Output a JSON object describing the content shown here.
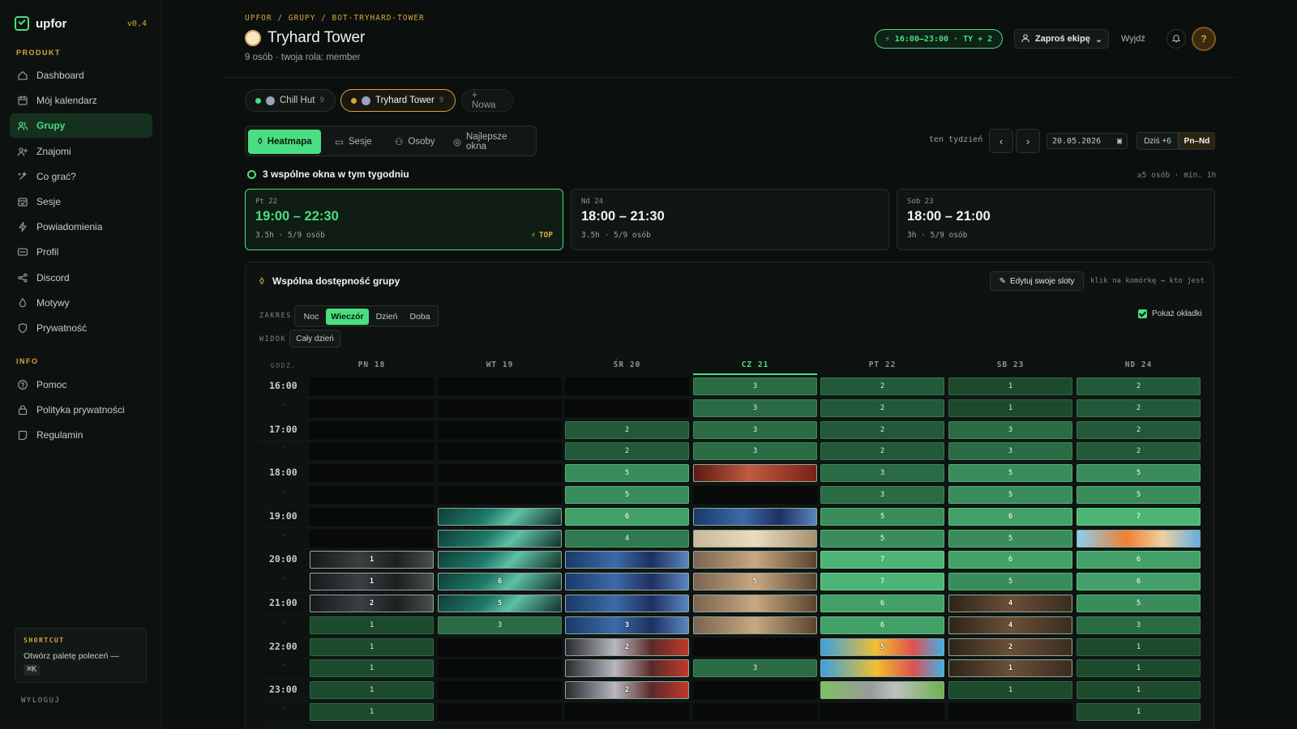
{
  "app": {
    "name": "upfor",
    "version": "v0.4"
  },
  "sidebar": {
    "section_product": "PRODUKT",
    "section_info": "INFO",
    "items": [
      {
        "label": "Dashboard",
        "icon": "home-icon"
      },
      {
        "label": "Mój kalendarz",
        "icon": "calendar-icon"
      },
      {
        "label": "Grupy",
        "icon": "users-icon",
        "active": true
      },
      {
        "label": "Znajomi",
        "icon": "user-plus-icon"
      },
      {
        "label": "Co grać?",
        "icon": "sparkles-icon"
      },
      {
        "label": "Sesje",
        "icon": "calendar-check-icon"
      },
      {
        "label": "Powiadomienia",
        "icon": "bolt-icon"
      },
      {
        "label": "Profil",
        "icon": "id-card-icon"
      },
      {
        "label": "Discord",
        "icon": "share-icon"
      },
      {
        "label": "Motywy",
        "icon": "drop-icon"
      },
      {
        "label": "Prywatność",
        "icon": "shield-icon"
      }
    ],
    "info_items": [
      {
        "label": "Pomoc",
        "icon": "help-circle-icon"
      },
      {
        "label": "Polityka prywatności",
        "icon": "lock-icon"
      },
      {
        "label": "Regulamin",
        "icon": "document-icon"
      }
    ],
    "shortcut_title": "SHORTCUT",
    "shortcut_text": "Otwórz paletę poleceń —",
    "shortcut_key": "⌘K",
    "logout": "WYLOGUJ"
  },
  "header": {
    "breadcrumb": "UPFOR / GRUPY / BOT-TRYHARD-TOWER",
    "title": "Tryhard Tower",
    "subtitle": "9 osób · twoja rola: member",
    "time_pill": "16:00–23:00 · TY + 2",
    "invite": "Zaproś ekipę",
    "logout": "Wyjdź"
  },
  "group_tabs": [
    {
      "name": "Chill Hut",
      "count": "9",
      "dot": "#4ade80"
    },
    {
      "name": "Tryhard Tower",
      "count": "9",
      "dot": "#d9a441",
      "active": true
    },
    {
      "name": "+ Nowa"
    }
  ],
  "view_tabs": [
    "Heatmapa",
    "Sesje",
    "Osoby",
    "Najlepsze okna"
  ],
  "week_nav": {
    "label": "ten tydzień",
    "date": "20.05.2026",
    "today": "Dziś +6",
    "range": "Pn–Nd"
  },
  "common_windows": {
    "title": "3 wspólne okna w tym tygodniu",
    "meta": "≥5 osób · min. 1h",
    "cards": [
      {
        "day": "Pt 22",
        "time": "19:00 – 22:30",
        "sub": "3.5h · 5/9 osób",
        "badge": "TOP"
      },
      {
        "day": "Nd 24",
        "time": "18:00 – 21:30",
        "sub": "3.5h · 5/9 osób"
      },
      {
        "day": "Sob 23",
        "time": "18:00 – 21:00",
        "sub": "3h · 5/9 osób"
      }
    ]
  },
  "panel": {
    "title": "Wspólna dostępność grupy",
    "edit": "Edytuj swoje sloty",
    "hint": "klik na komórkę → kto jest",
    "range_label": "ZAKRES",
    "range": [
      "Noc",
      "Wieczór",
      "Dzień",
      "Doba"
    ],
    "view_label": "WIDOK",
    "view": "Cały dzień",
    "covers": "Pokaż okładki",
    "godz": "GODZ.",
    "days": [
      "PN 18",
      "WT 19",
      "ŚR 20",
      "CZ 21",
      "PT 22",
      "SB 23",
      "ND 24"
    ],
    "hours": [
      "16:00",
      "17:00",
      "18:00",
      "19:00",
      "20:00",
      "21:00",
      "22:00",
      "23:00"
    ],
    "grid": [
      [
        "",
        "",
        "",
        "3",
        "2",
        "1",
        "2"
      ],
      [
        "",
        "",
        "",
        "3",
        "2",
        "1",
        "2"
      ],
      [
        "",
        "",
        "2",
        "3",
        "2",
        "3",
        "2"
      ],
      [
        "",
        "",
        "2",
        "3",
        "2",
        "3",
        "2"
      ],
      [
        "",
        "",
        "5",
        "",
        "3",
        "5",
        "5"
      ],
      [
        "",
        "",
        "5",
        "",
        "3",
        "5",
        "5"
      ],
      [
        "",
        "",
        "6",
        "",
        "5",
        "6",
        "7"
      ],
      [
        "",
        "",
        "4",
        "",
        "5",
        "5",
        ""
      ],
      [
        "1",
        "",
        "",
        "",
        "7",
        "6",
        "6"
      ],
      [
        "1",
        "6",
        "",
        "5",
        "7",
        "5",
        "6"
      ],
      [
        "2",
        "5",
        "",
        "",
        "6",
        "4",
        "5"
      ],
      [
        "1",
        "3",
        "3",
        "",
        "6",
        "4",
        "3"
      ],
      [
        "1",
        "",
        "2",
        "",
        "5",
        "2",
        "1"
      ],
      [
        "1",
        "",
        "",
        "3",
        "",
        "1",
        "1"
      ],
      [
        "1",
        "",
        "2",
        "",
        "",
        "1",
        "1"
      ],
      [
        "1",
        "",
        "",
        "",
        "",
        "",
        "1"
      ]
    ]
  }
}
